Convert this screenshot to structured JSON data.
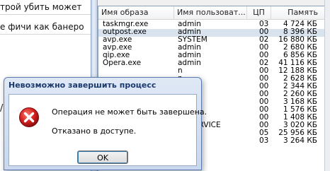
{
  "background_window": {
    "lines": [
      "трой убить может",
      "е фичи как банеро",
      "/"
    ]
  },
  "dialog": {
    "title": "Невозможно завершить процесс",
    "message": "Операция не может быть завершена.",
    "detail": "Отказано в доступе.",
    "ok_label": "OK",
    "icon": "error-icon"
  },
  "process_list": {
    "columns": [
      "Имя образа",
      "Имя пользоват...",
      "ЦП",
      "Память"
    ],
    "rows": [
      {
        "name": "taskmgr.exe",
        "user": "admin",
        "cpu": "03",
        "mem": "4 724 КБ",
        "selected": false
      },
      {
        "name": "outpost.exe",
        "user": "admin",
        "cpu": "00",
        "mem": "8 396 КБ",
        "selected": true
      },
      {
        "name": "avp.exe",
        "user": "SYSTEM",
        "cpu": "02",
        "mem": "16 880 КБ",
        "selected": false
      },
      {
        "name": "avp.exe",
        "user": "admin",
        "cpu": "00",
        "mem": "2 680 КБ",
        "selected": false
      },
      {
        "name": "qip.exe",
        "user": "admin",
        "cpu": "00",
        "mem": "6 856 КБ",
        "selected": false
      },
      {
        "name": "Opera.exe",
        "user": "admin",
        "cpu": "02",
        "mem": "41 116 КБ",
        "selected": false
      },
      {
        "name": "",
        "user": "n",
        "cpu": "00",
        "mem": "12 188 КБ",
        "selected": false
      },
      {
        "name": "",
        "user": "n",
        "cpu": "00",
        "mem": "2 628 КБ",
        "selected": false
      },
      {
        "name": "",
        "user": "n",
        "cpu": "00",
        "mem": "2 344 КБ",
        "selected": false
      },
      {
        "name": "",
        "user": "n",
        "cpu": "00",
        "mem": "2 260 КБ",
        "selected": false
      },
      {
        "name": "",
        "user": "n",
        "cpu": "00",
        "mem": "3 168 КБ",
        "selected": false
      },
      {
        "name": "",
        "user": "n",
        "cpu": "00",
        "mem": "1 576 КБ",
        "selected": false
      },
      {
        "name": "",
        "user": "n",
        "cpu": "00",
        "mem": "1 408 КБ",
        "selected": false
      },
      {
        "name": "",
        "user": "AL SERVICE",
        "cpu": "00",
        "mem": "3 020 КБ",
        "selected": false
      },
      {
        "name": "",
        "user": "n",
        "cpu": "05",
        "mem": "25 956 КБ",
        "selected": false
      },
      {
        "name": "",
        "user": "n",
        "cpu": "03",
        "mem": "3 264 КБ",
        "selected": false
      }
    ]
  },
  "colors": {
    "dialog_title": "#1a3a6e",
    "selection": "#d9e3ee",
    "error_red": "#d42020"
  }
}
